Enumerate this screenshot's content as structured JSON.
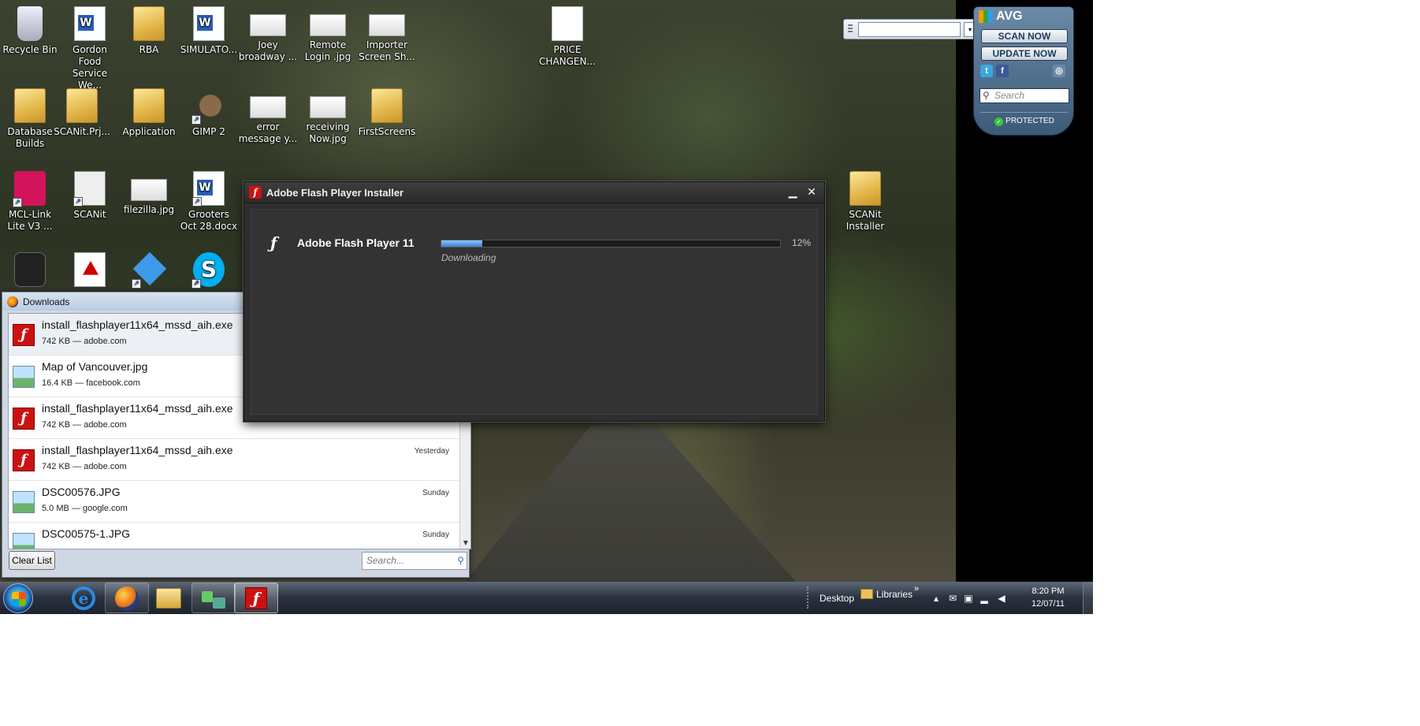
{
  "desktop": {
    "icons": [
      {
        "id": "recycle",
        "label": "Recycle Bin",
        "icon": "recycle-bin-icon",
        "kind": "bin"
      },
      {
        "id": "gfs",
        "label": "Gordon Food Service We...",
        "icon": "word-document-icon",
        "kind": "word"
      },
      {
        "id": "rba",
        "label": "RBA",
        "icon": "folder-icon",
        "kind": "folder"
      },
      {
        "id": "sim",
        "label": "SIMULATO...",
        "icon": "word-document-icon",
        "kind": "word"
      },
      {
        "id": "joey",
        "label": "Joey broadway ...",
        "icon": "image-file-icon",
        "kind": "thumb"
      },
      {
        "id": "remote",
        "label": "Remote Login .jpg",
        "icon": "image-file-icon",
        "kind": "thumb"
      },
      {
        "id": "importer",
        "label": "Importer Screen Sh...",
        "icon": "image-file-icon",
        "kind": "thumb"
      },
      {
        "id": "price",
        "label": "PRICE CHANGEN...",
        "icon": "blank-document-icon",
        "kind": "paper"
      },
      {
        "id": "dbbuilds",
        "label": "Database Builds",
        "icon": "folder-icon",
        "kind": "folder"
      },
      {
        "id": "scanitprj",
        "label": "SCANit.Prj...",
        "icon": "zip-folder-icon",
        "kind": "folder"
      },
      {
        "id": "application",
        "label": "Application",
        "icon": "folder-icon",
        "kind": "folder"
      },
      {
        "id": "gimp",
        "label": "GIMP 2",
        "icon": "gimp-icon",
        "kind": "gimp"
      },
      {
        "id": "errmsg",
        "label": "error message y...",
        "icon": "image-file-icon",
        "kind": "thumb"
      },
      {
        "id": "receiving",
        "label": "receiving Now.jpg",
        "icon": "image-file-icon",
        "kind": "thumb"
      },
      {
        "id": "firstscreens",
        "label": "FirstScreens",
        "icon": "folder-icon",
        "kind": "folder"
      },
      {
        "id": "mcl",
        "label": "MCL-Link Lite V3 ...",
        "icon": "mcl-link-icon",
        "kind": "mcl"
      },
      {
        "id": "scanit",
        "label": "SCANit",
        "icon": "scanit-icon",
        "kind": "scanit"
      },
      {
        "id": "filezilla",
        "label": "filezilla.jpg",
        "icon": "image-file-icon",
        "kind": "thumb"
      },
      {
        "id": "grooters",
        "label": "Grooters Oct 28.docx",
        "icon": "word-document-icon",
        "kind": "word"
      },
      {
        "id": "scanitinst",
        "label": "SCANit Installer",
        "icon": "folder-icon",
        "kind": "folder"
      },
      {
        "id": "bb",
        "label": "",
        "icon": "blackberry-icon",
        "kind": "bb"
      },
      {
        "id": "pdf",
        "label": "",
        "icon": "pdf-icon",
        "kind": "pdf"
      },
      {
        "id": "dropbox",
        "label": "",
        "icon": "dropbox-icon",
        "kind": "dbx"
      },
      {
        "id": "skype",
        "label": "",
        "icon": "skype-icon",
        "kind": "skype"
      }
    ]
  },
  "floating_toolbar": {
    "input_value": "",
    "dropdown_glyph": "▾",
    "square_glyph": "□"
  },
  "avg": {
    "title": "AVG",
    "scan_now": "SCAN NOW",
    "update_now": "UPDATE NOW",
    "search_placeholder": "Search",
    "status": "PROTECTED",
    "status_color": "#33cc33",
    "social": [
      {
        "icon": "twitter-icon",
        "glyph": "t",
        "color": "#3aa7e0"
      },
      {
        "icon": "facebook-icon",
        "glyph": "f",
        "color": "#3b5998"
      },
      {
        "icon": "camera-icon",
        "glyph": "◎",
        "color": "#6a8aa6"
      }
    ]
  },
  "flash_installer": {
    "title": "Adobe Flash Player Installer",
    "minimize_glyph": "▁",
    "close_glyph": "✕",
    "product": "Adobe Flash Player 11",
    "progress_percent": 12,
    "progress_label": "12%",
    "status": "Downloading",
    "accent": "#cc1111"
  },
  "downloads": {
    "title": "Downloads",
    "items": [
      {
        "name": "install_flashplayer11x64_mssd_aih.exe",
        "meta": "742 KB — adobe.com",
        "when": "",
        "type": "flash",
        "selected": true
      },
      {
        "name": "Map of Vancouver.jpg",
        "meta": "16.4 KB — facebook.com",
        "when": "",
        "type": "image",
        "selected": false
      },
      {
        "name": "install_flashplayer11x64_mssd_aih.exe",
        "meta": "742 KB — adobe.com",
        "when": "",
        "type": "flash",
        "selected": false
      },
      {
        "name": "install_flashplayer11x64_mssd_aih.exe",
        "meta": "742 KB — adobe.com",
        "when": "Yesterday",
        "type": "flash",
        "selected": false
      },
      {
        "name": "DSC00576.JPG",
        "meta": "5.0 MB — google.com",
        "when": "Sunday",
        "type": "image",
        "selected": false
      },
      {
        "name": "DSC00575-1.JPG",
        "meta": "",
        "when": "Sunday",
        "type": "image",
        "selected": false
      }
    ],
    "clear_list": "Clear List",
    "search_placeholder": "Search..."
  },
  "taskbar": {
    "items": [
      {
        "id": "ie",
        "icon": "internet-explorer-icon",
        "state": "normal"
      },
      {
        "id": "firefox",
        "icon": "firefox-icon",
        "state": "pinned"
      },
      {
        "id": "explorer",
        "icon": "windows-explorer-icon",
        "state": "normal"
      },
      {
        "id": "network",
        "icon": "network-app-icon",
        "state": "pinned"
      },
      {
        "id": "flash",
        "icon": "flash-player-icon",
        "state": "active"
      }
    ],
    "desktop_label": "Desktop",
    "libraries_label": "Libraries",
    "chevron": "»",
    "tray": [
      {
        "icon": "show-hidden-icons-icon",
        "glyph": "▴"
      },
      {
        "icon": "mail-icon",
        "glyph": "✉"
      },
      {
        "icon": "device-icon",
        "glyph": "▣"
      },
      {
        "icon": "signal-icon",
        "glyph": "▂"
      },
      {
        "icon": "volume-icon",
        "glyph": "◀"
      }
    ],
    "time": "8:20 PM",
    "date": "12/07/11"
  }
}
